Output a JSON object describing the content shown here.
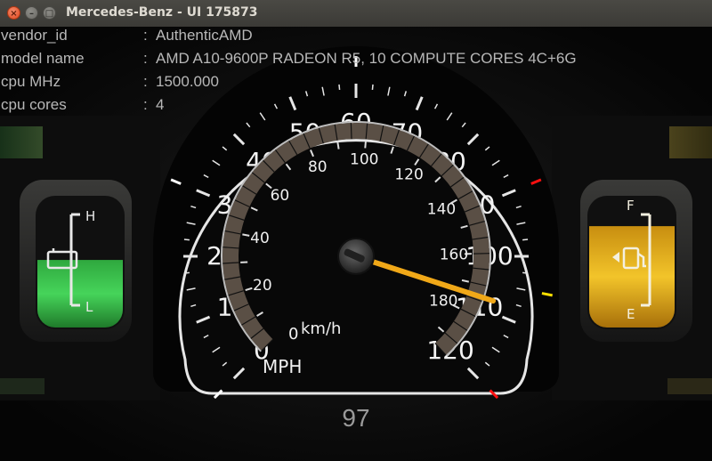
{
  "window": {
    "title": "Mercedes-Benz - UI 175873",
    "controls": {
      "close": "×",
      "minimize": "–",
      "maximize": "□"
    }
  },
  "cpu_info": [
    {
      "key": "vendor_id",
      "sep": ":",
      "value": "AuthenticAMD"
    },
    {
      "key": "model name",
      "sep": ":",
      "value": "AMD A10-9600P RADEON R5, 10 COMPUTE CORES 4C+6G"
    },
    {
      "key": "cpu MHz",
      "sep": ":",
      "value": "1500.000"
    },
    {
      "key": "cpu cores",
      "sep": ":",
      "value": "4"
    }
  ],
  "speedometer": {
    "mph_labels": [
      "0",
      "10",
      "20",
      "30",
      "40",
      "50",
      "60",
      "70",
      "80",
      "90",
      "100",
      "110",
      "120"
    ],
    "kmh_labels": [
      "20",
      "40",
      "60",
      "80",
      "100",
      "120",
      "140",
      "160",
      "180"
    ],
    "kmh_zero": "0",
    "unit_mph": "MPH",
    "unit_kmh": "km/h",
    "needle_mph": 108,
    "needle_color": "#f0a818",
    "readout": "97"
  },
  "battery_gauge": {
    "high_label": "H",
    "low_label": "L",
    "level": 0.52,
    "color": "#35c24a"
  },
  "fuel_gauge": {
    "full_label": "F",
    "empty_label": "E",
    "level": 0.78,
    "color": "#e8b81c"
  }
}
